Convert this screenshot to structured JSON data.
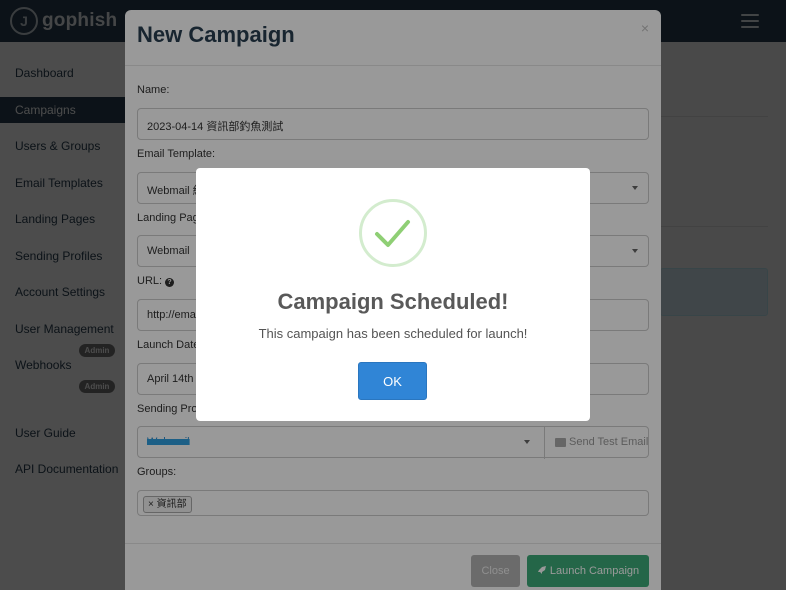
{
  "navbar": {
    "brand": "gophish",
    "brand_logo_letter": "J",
    "menu_icon": "hamburger-icon"
  },
  "sidebar": {
    "items": [
      {
        "label": "Dashboard"
      },
      {
        "label": "Campaigns",
        "active": true
      },
      {
        "label": "Users & Groups"
      },
      {
        "label": "Email Templates"
      },
      {
        "label": "Landing Pages"
      },
      {
        "label": "Sending Profiles"
      },
      {
        "label": "Account Settings"
      },
      {
        "label": "User Management",
        "badge": "Admin"
      },
      {
        "label": "Webhooks",
        "badge": "Admin"
      },
      {
        "label": "User Guide"
      },
      {
        "label": "API Documentation"
      }
    ]
  },
  "modal": {
    "title": "New Campaign",
    "close_glyph": "×",
    "fields": {
      "name_label": "Name:",
      "name_value": "2023-04-14 資訊部釣魚測試",
      "template_label": "Email Template:",
      "template_value": "Webmail 紅",
      "landing_label": "Landing Pag",
      "landing_value": "Webmail",
      "url_label": "URL:",
      "url_value": "http://ema",
      "launch_label": "Launch Date",
      "launch_value": "April 14th 2",
      "sending_label": "Sending Prof",
      "sending_value": "Webmail",
      "send_test_label": "Send Test Email",
      "groups_label": "Groups:",
      "group_tag": "× 資訊部"
    },
    "buttons": {
      "close": "Close",
      "launch": "Launch Campaign"
    }
  },
  "alert": {
    "icon": "success-check-icon",
    "title": "Campaign Scheduled!",
    "text": "This campaign has been scheduled for launch!",
    "ok": "OK"
  },
  "colors": {
    "navbar": "#283f50",
    "active": "#283f50",
    "launch": "#3cab78",
    "ok": "#3085d6",
    "check": "#8fcf75"
  }
}
